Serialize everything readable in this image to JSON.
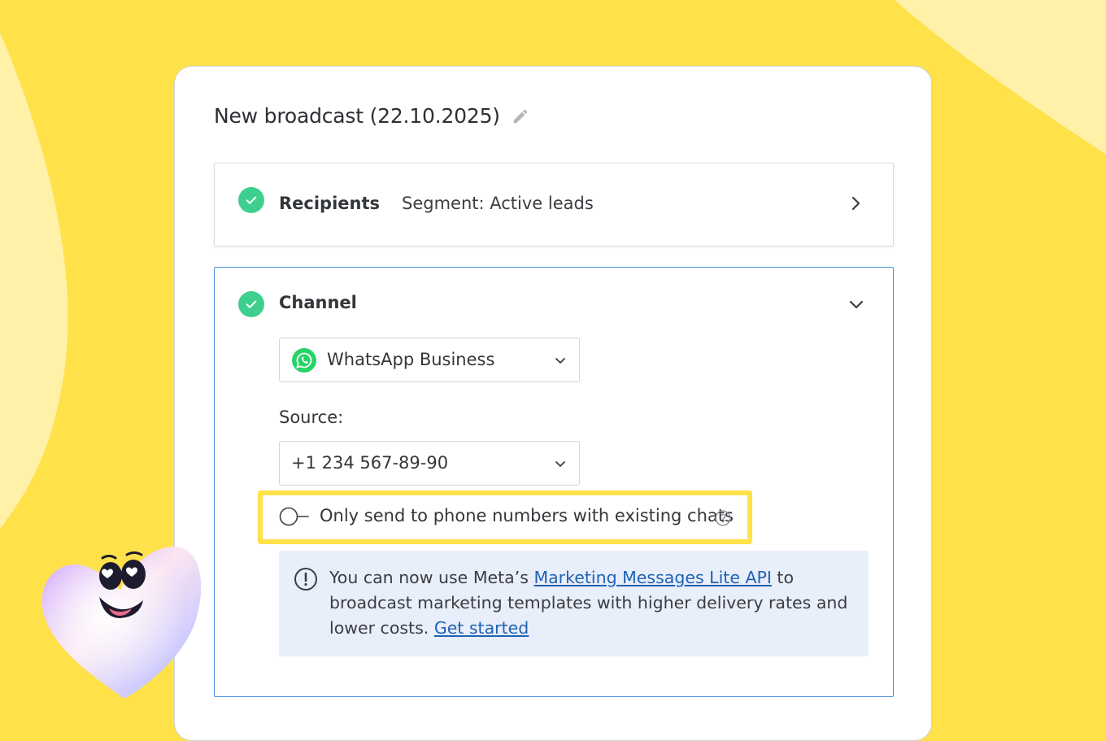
{
  "broadcast": {
    "title": "New broadcast (22.10.2025)"
  },
  "recipients": {
    "label": "Recipients",
    "value": "Segment: Active leads"
  },
  "channel": {
    "label": "Channel",
    "selected_channel": "WhatsApp Business",
    "source_label": "Source:",
    "source_value": "+1 234 567-89-90",
    "toggle_label": "Only send to phone numbers with existing chats",
    "toggle_on": false
  },
  "info": {
    "text_before": "You can now use Meta’s ",
    "link_api": "Marketing Messages Lite API",
    "text_after": " to broadcast marketing templates with higher delivery rates and lower costs. ",
    "link_start": "Get started"
  },
  "icons": {
    "edit": "pencil-icon",
    "check": "check-circle-icon",
    "chevron_right": "chevron-right-icon",
    "chevron_down": "chevron-down-icon",
    "whatsapp": "whatsapp-icon",
    "help": "question-circle-icon",
    "info": "exclamation-circle-icon"
  },
  "colors": {
    "background": "#FFE14A",
    "check_green": "#3ecf8e",
    "active_border": "#4a8fe0",
    "highlight": "#FFE14A",
    "info_bg": "#e8eefa",
    "link": "#1f62b3",
    "whatsapp": "#25D366"
  }
}
